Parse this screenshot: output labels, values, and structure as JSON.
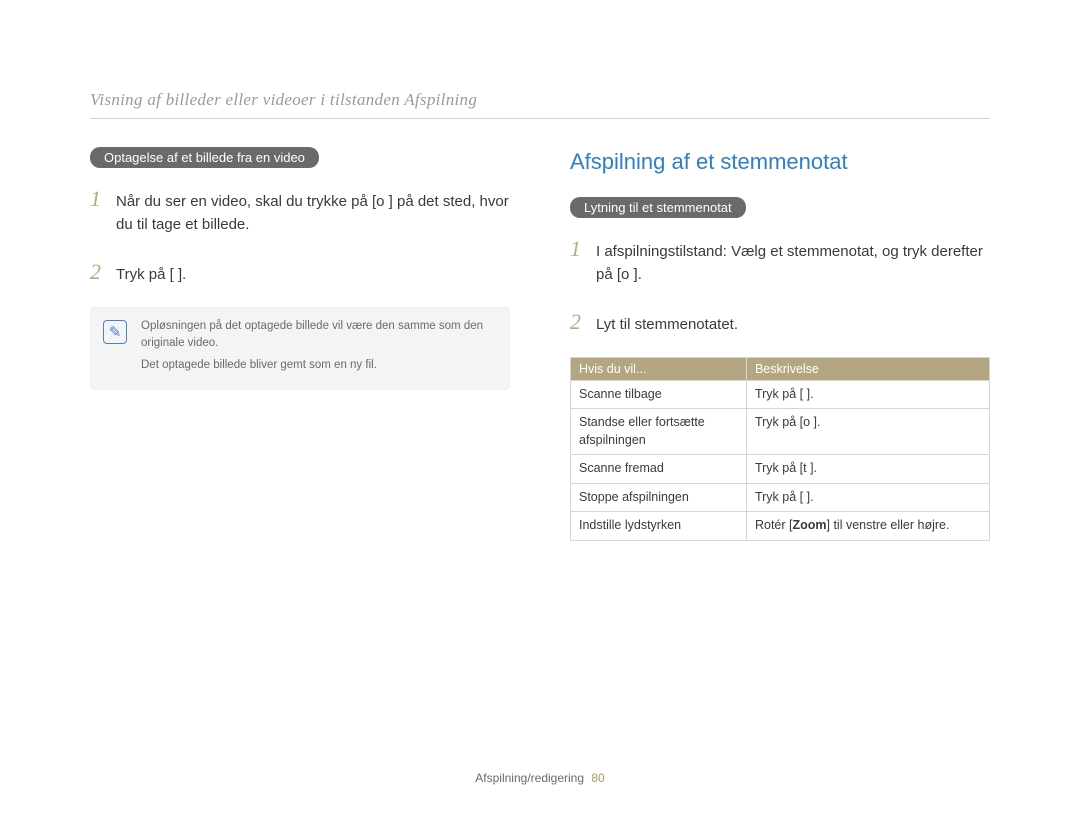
{
  "header": {
    "breadcrumb": "Visning af billeder eller videoer i tilstanden Afspilning"
  },
  "left": {
    "section_label": "Optagelse af et billede fra en video",
    "step1": "Når du ser en video, skal du trykke på [o   ] på det sted, hvor du til tage et billede.",
    "step2": "Tryk på [     ].",
    "note1": "Opløsningen på det optagede billede vil være den samme som den originale video.",
    "note2": "Det optagede billede bliver gemt som en ny fil."
  },
  "right": {
    "heading": "Afspilning af et stemmenotat",
    "section_label": "Lytning til et stemmenotat",
    "step1": "I afspilningstilstand: Vælg et stemmenotat, og tryk derefter på [o   ].",
    "step2": "Lyt til stemmenotatet.",
    "table_headers": {
      "col1": "Hvis du vil...",
      "col2": "Beskrivelse"
    },
    "rows": [
      {
        "action": "Scanne tilbage",
        "desc": "Tryk på [     ]."
      },
      {
        "action": "Standse eller fortsætte afspilningen",
        "desc": "Tryk på [o   ]."
      },
      {
        "action": "Scanne fremad",
        "desc": "Tryk på [t    ]."
      },
      {
        "action": "Stoppe afspilningen",
        "desc": "Tryk på [     ]."
      },
      {
        "action": "Indstille lydstyrken",
        "desc_prefix": "Rotér [",
        "desc_bold": "Zoom",
        "desc_suffix": "] til venstre eller højre."
      }
    ]
  },
  "footer": {
    "section": "Afspilning/redigering",
    "page": "80"
  }
}
